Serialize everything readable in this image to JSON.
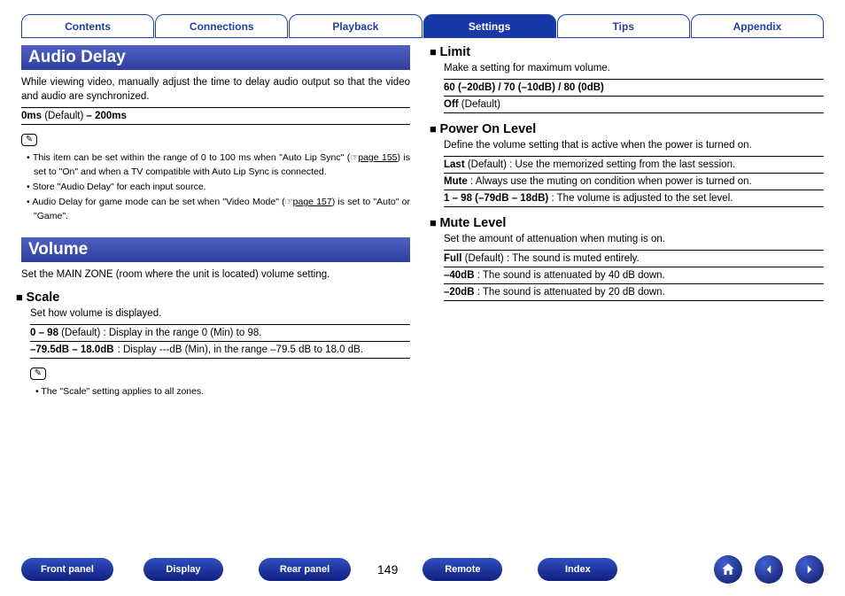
{
  "tabs": [
    "Contents",
    "Connections",
    "Playback",
    "Settings",
    "Tips",
    "Appendix"
  ],
  "active_tab": 3,
  "left": {
    "audio_delay": {
      "title": "Audio Delay",
      "desc": "While viewing video, manually adjust the time to delay audio output so that the video and audio are synchronized.",
      "range_b1": "0ms",
      "range_def": " (Default) ",
      "range_b2": "– 200ms",
      "notes": {
        "n1a": "This item can be set within the range of 0 to 100 ms when \"Auto Lip Sync\" (",
        "n1_hand": "☞",
        "n1_link": "page 155",
        "n1b": ") is set to \"On\" and when a TV compatible with Auto Lip Sync is connected.",
        "n2": "Store \"Audio Delay\" for each input source.",
        "n3a": "Audio Delay for game mode can be set when \"Video Mode\" (",
        "n3_link": "page 157",
        "n3b": ") is set to \"Auto\" or \"Game\"."
      }
    },
    "volume": {
      "title": "Volume",
      "desc": "Set the MAIN ZONE (room where the unit is located) volume setting.",
      "scale": {
        "head": "Scale",
        "desc": "Set how volume is displayed.",
        "r1b": "0 – 98",
        "r1def": " (Default)",
        "r1rest": " : Display in the range 0 (Min) to 98.",
        "r2b": "–79.5dB – 18.0dB",
        "r2rest": " : Display ---dB (Min), in the range –79.5 dB to 18.0 dB.",
        "note": "The \"Scale\" setting applies to all zones."
      }
    }
  },
  "right": {
    "limit": {
      "head": "Limit",
      "desc": "Make a setting for maximum volume.",
      "r1": "60 (–20dB) / 70 (–10dB) / 80 (0dB)",
      "r2b": "Off",
      "r2def": " (Default)"
    },
    "power": {
      "head": "Power On Level",
      "desc": "Define the volume setting that is active when the power is turned on.",
      "r1b": "Last",
      "r1def": " (Default)",
      "r1rest": " : Use the memorized setting from the last session.",
      "r2b": "Mute",
      "r2rest": " : Always use the muting on condition when power is turned on.",
      "r3b": "1 – 98 (–79dB – 18dB)",
      "r3rest": " : The volume is adjusted to the set level."
    },
    "mute": {
      "head": "Mute Level",
      "desc": "Set the amount of attenuation when muting is on.",
      "r1b": "Full",
      "r1def": " (Default)",
      "r1rest": " : The sound is muted entirely.",
      "r2b": "–40dB",
      "r2rest": " : The sound is attenuated by 40 dB down.",
      "r3b": "–20dB",
      "r3rest": " : The sound is attenuated by 20 dB down."
    }
  },
  "page_number": "149",
  "bottom_pills": [
    "Front panel",
    "Display",
    "Rear panel",
    "Remote",
    "Index"
  ]
}
